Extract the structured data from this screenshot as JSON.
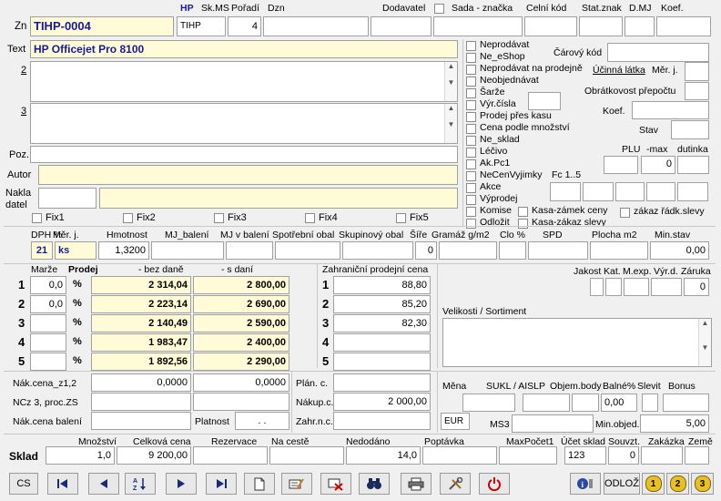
{
  "header": {
    "zn_label": "Zn",
    "zn_value": "TIHP-0004",
    "hp_label": "HP",
    "skms_label": "Sk.MS",
    "skms_value": "TIHP",
    "poradi_label": "Pořadí",
    "poradi_value": "4",
    "dzn_label": "Dzn",
    "dodavatel_label": "Dodavatel",
    "sada_label": "Sada - značka",
    "celni_label": "Celní kód",
    "statznak_label": "Stat.znak",
    "dmj_label": "D.MJ",
    "koef_label": "Koef."
  },
  "text_section": {
    "text_label": "Text",
    "text_value": "HP Officejet Pro 8100",
    "line2_label": "2",
    "line3_label": "3",
    "poz_label": "Poz.",
    "autor_label": "Autor",
    "nakladatel_label_1": "Nakla",
    "nakladatel_label_2": "datel",
    "fix": [
      "Fix1",
      "Fix2",
      "Fix3",
      "Fix4",
      "Fix5"
    ]
  },
  "flags": {
    "left": [
      "Neprodávat",
      "Ne_eShop",
      "Neprodávat na prodejně",
      "Neobjednávat",
      "Šarže",
      "Výr.čísla",
      "Prodej přes kasu",
      "Cena podle množství",
      "Ne_sklad",
      "Léčivo",
      "Ak.Pc1",
      "NeCenVyjimky",
      "Akce",
      "Výprodej",
      "Komise",
      "Odložit"
    ],
    "fc_label": "Fc 1..5",
    "kasa_zamek": "Kasa-zámek ceny",
    "kasa_zakaz": "Kasa-zákaz slevy",
    "zakaz_radk": "zákaz řádk.slevy",
    "carovy_kod": "Čárový kód",
    "ucinna_latka": "Účinná látka",
    "mer_j": "Měr. j.",
    "obratkovost": "Obrátkovost přepočtu",
    "koef": "Koef.",
    "stav": "Stav",
    "plu": "PLU",
    "max": "-max",
    "dutinka": "dutinka",
    "max_value": "0"
  },
  "props": {
    "labels": [
      "DPH %",
      "Měr. j.",
      "Hmotnost",
      "MJ_balení",
      "MJ v balení",
      "Spotřební obal",
      "Skupinový obal",
      "Šíře",
      "Gramáž g/m2",
      "Clo %",
      "SPD",
      "Plocha m2",
      "Min.stav"
    ],
    "dph": "21",
    "merj": "ks",
    "hmotnost": "1,3200",
    "sire": "0",
    "minstav": "0,00"
  },
  "prices": {
    "marze_label": "Marže",
    "prodej_label": "Prodej",
    "bez_dane_label": "- bez daně",
    "s_dani_label": "- s daní",
    "zahranicni_label": "Zahraniční prodejní cena",
    "rows": [
      {
        "n": "1",
        "marze": "0,0",
        "unit": "%",
        "bez": "2 314,04",
        "s": "2 800,00",
        "zahr": "88,80"
      },
      {
        "n": "2",
        "marze": "0,0",
        "unit": "%",
        "bez": "2 223,14",
        "s": "2 690,00",
        "zahr": "85,20"
      },
      {
        "n": "3",
        "marze": "",
        "unit": "%",
        "bez": "2 140,49",
        "s": "2 590,00",
        "zahr": "82,30"
      },
      {
        "n": "4",
        "marze": "",
        "unit": "%",
        "bez": "1 983,47",
        "s": "2 400,00",
        "zahr": ""
      },
      {
        "n": "5",
        "marze": "",
        "unit": "%",
        "bez": "1 892,56",
        "s": "2 290,00",
        "zahr": ""
      }
    ],
    "jakost_labels": [
      "Jakost",
      "Kat.",
      "M.exp.",
      "Výr.d.",
      "Záruka"
    ],
    "zaruka_value": "0",
    "velikosti_label": "Velikosti / Sortiment"
  },
  "costs": {
    "nak_z12_label": "Nák.cena_z1,2",
    "nak_z12_v1": "0,0000",
    "nak_z12_v2": "0,0000",
    "ncz3_label": "NCz 3, proc.ZS",
    "nak_bal_label": "Nák.cena balení",
    "platnost_label": "Platnost",
    "platnost_value": ". .",
    "plan_label": "Plán. c.",
    "nakup_label": "Nákup.c.",
    "nakup_value": "2 000,00",
    "zahr_label": "Zahr.n.c.",
    "mena_label": "Měna",
    "mena_value": "EUR",
    "sukl_label": "SUKL / AISLP",
    "objem_label": "Objem.body",
    "balne_label": "Balné%",
    "slevit_label": "Slevit",
    "bonus_label": "Bonus",
    "balne_value": "0,00",
    "ms3_label": "MS3",
    "min_objed_label": "Min.objed.",
    "min_objed_value": "5,00"
  },
  "sklad": {
    "label": "Sklad",
    "col_labels": [
      "Množství",
      "Celková cena",
      "Rezervace",
      "Na cestě",
      "Nedodáno",
      "Poptávka",
      "MaxPočet1",
      "Účet sklad",
      "Souvzt.",
      "Zakázka",
      "Země"
    ],
    "mnozstvi": "1,0",
    "celkova": "9 200,00",
    "nedodano": "14,0",
    "ucet": "123",
    "souvzt": "0"
  },
  "toolbar": {
    "cs_label": "CS",
    "odloz_label": "ODLOŽ",
    "badge1": "1",
    "badge2": "2",
    "badge3": "3"
  },
  "colors": {
    "yellow_field": "#fffbd6",
    "blue_text": "#1a1a9a",
    "power_red": "#cc0000"
  }
}
